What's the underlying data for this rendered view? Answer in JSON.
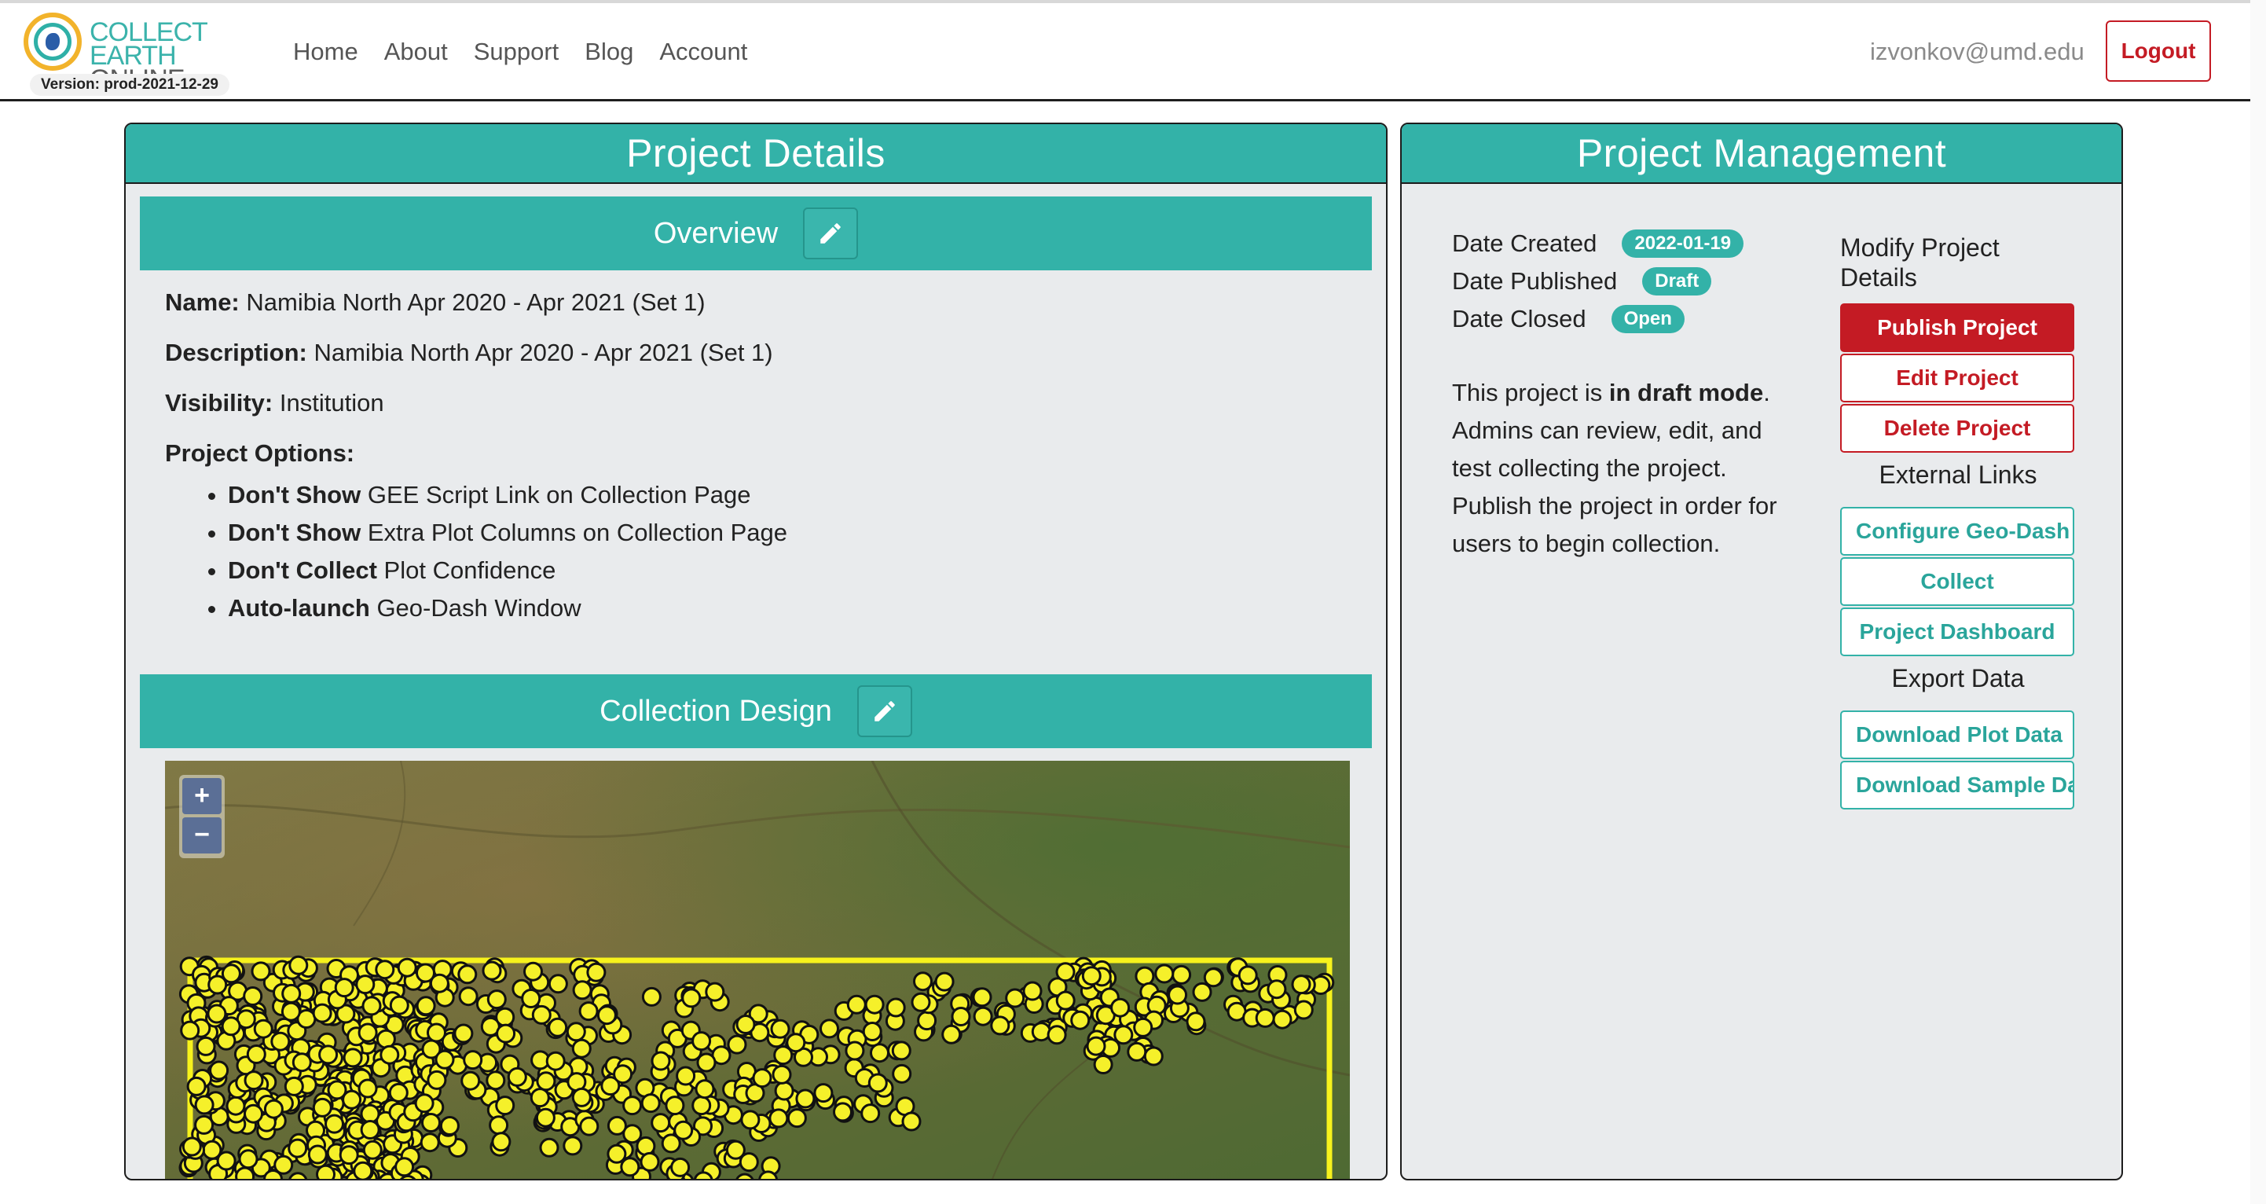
{
  "brand": {
    "line1": "COLLECT EARTH",
    "line2": "ONLINE",
    "version": "Version: prod-2021-12-29"
  },
  "nav": {
    "links": [
      "Home",
      "About",
      "Support",
      "Blog",
      "Account"
    ],
    "user_email": "izvonkov@umd.edu",
    "logout_label": "Logout"
  },
  "details_panel": {
    "title": "Project Details",
    "overview": {
      "title": "Overview",
      "name_label": "Name:",
      "name_value": "Namibia North Apr 2020 - Apr 2021 (Set 1)",
      "description_label": "Description:",
      "description_value": "Namibia North Apr 2020 - Apr 2021 (Set 1)",
      "visibility_label": "Visibility:",
      "visibility_value": "Institution",
      "options_label": "Project Options:",
      "options": [
        {
          "bold": "Don't Show",
          "text": "GEE Script Link on Collection Page"
        },
        {
          "bold": "Don't Show",
          "text": "Extra Plot Columns on Collection Page"
        },
        {
          "bold": "Don't Collect",
          "text": "Plot Confidence"
        },
        {
          "bold": "Auto-launch",
          "text": "Geo-Dash Window"
        }
      ]
    },
    "collection_design": {
      "title": "Collection Design",
      "zoom_in": "+",
      "zoom_out": "−",
      "boundary_color": "#f7f21c",
      "plot_color": "#f5f02a"
    }
  },
  "management_panel": {
    "title": "Project Management",
    "dates": {
      "created_label": "Date Created",
      "created_value": "2022-01-19",
      "published_label": "Date Published",
      "published_value": "Draft",
      "closed_label": "Date Closed",
      "closed_value": "Open"
    },
    "status": {
      "prefix": "This project is ",
      "mode": "in draft mode",
      "suffix": ". Admins can review, edit, and test collecting the project. Publish the project in order for users to begin collection."
    },
    "modify_heading": "Modify Project Details",
    "publish_label": "Publish Project",
    "edit_label": "Edit Project",
    "delete_label": "Delete Project",
    "external_heading": "External Links",
    "configure_label": "Configure Geo-Dash",
    "collect_label": "Collect",
    "dashboard_label": "Project Dashboard",
    "export_heading": "Export Data",
    "download_plot_label": "Download Plot Data",
    "download_sample_label": "Download Sample Data"
  },
  "colors": {
    "accent": "#33b2a8",
    "danger": "#c41b24",
    "panel_bg": "#e9ebed"
  }
}
